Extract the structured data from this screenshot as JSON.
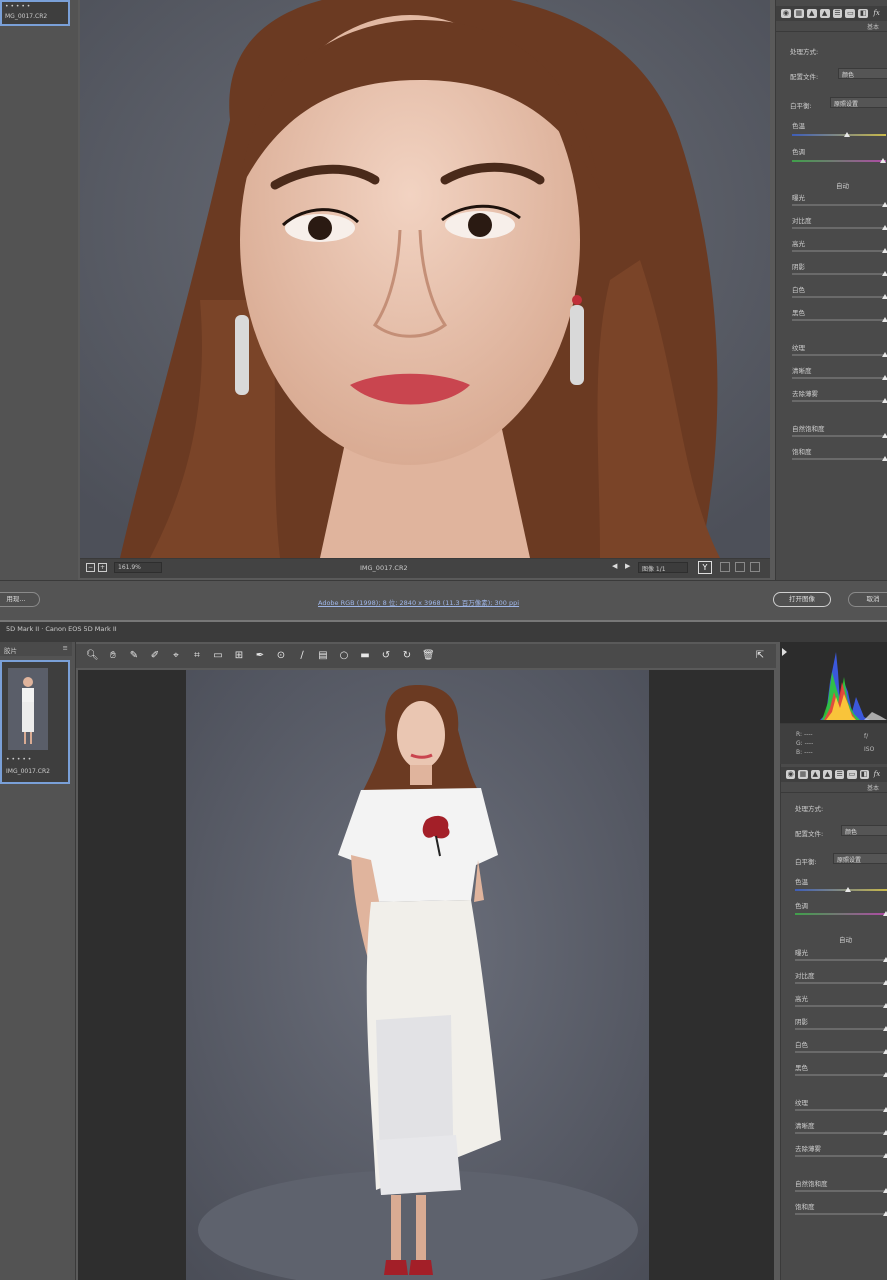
{
  "top": {
    "filmstrip": {
      "thumb_label": "MG_0017.CR2"
    },
    "status": {
      "zoom": "161.9%",
      "filename": "IMG_0017.CR2",
      "image_counter": "图像 1/1"
    },
    "panel": {
      "section": "基本",
      "processing_label": "处理方式:",
      "profile_label": "配置文件:",
      "profile_value": "颜色",
      "wb_label": "白平衡:",
      "wb_value": "原照设置",
      "temp_label": "色温",
      "tint_label": "色调",
      "auto_label": "自动",
      "sliders": [
        "曝光",
        "对比度",
        "高光",
        "阴影",
        "白色",
        "黑色",
        "纹理",
        "清晰度",
        "去除薄雾",
        "自然饱和度",
        "饱和度"
      ]
    }
  },
  "bottom_bar": {
    "left_button": "用现...",
    "info_link": "Adobe RGB (1998); 8 位; 2840 x 3968 (11.3 百万像素); 300 ppi",
    "open_button": "打开图像",
    "cancel_button": "取消"
  },
  "bottom": {
    "title": "5D Mark II · Canon EOS 5D Mark II",
    "filmstrip": {
      "header": "胶片",
      "thumb_label": "IMG_0017.CR2"
    },
    "histogram": {
      "readout_labels": [
        "R:",
        "G:",
        "B:"
      ],
      "readout_values": [
        "----",
        "----",
        "----"
      ],
      "right_values": [
        "f/",
        "ISO"
      ]
    },
    "panel": {
      "section": "基本",
      "processing_label": "处理方式:",
      "profile_label": "配置文件:",
      "profile_value": "颜色",
      "wb_label": "白平衡:",
      "wb_value": "原照设置",
      "temp_label": "色温",
      "tint_label": "色调",
      "auto_label": "自动",
      "sliders": [
        "曝光",
        "对比度",
        "高光",
        "阴影",
        "白色",
        "黑色",
        "纹理",
        "清晰度",
        "去除薄雾",
        "自然饱和度",
        "饱和度"
      ]
    }
  },
  "colors": {
    "accent": "#7aa0d8",
    "panel_bg": "#4a4a4a",
    "backdrop": "#565a66"
  }
}
